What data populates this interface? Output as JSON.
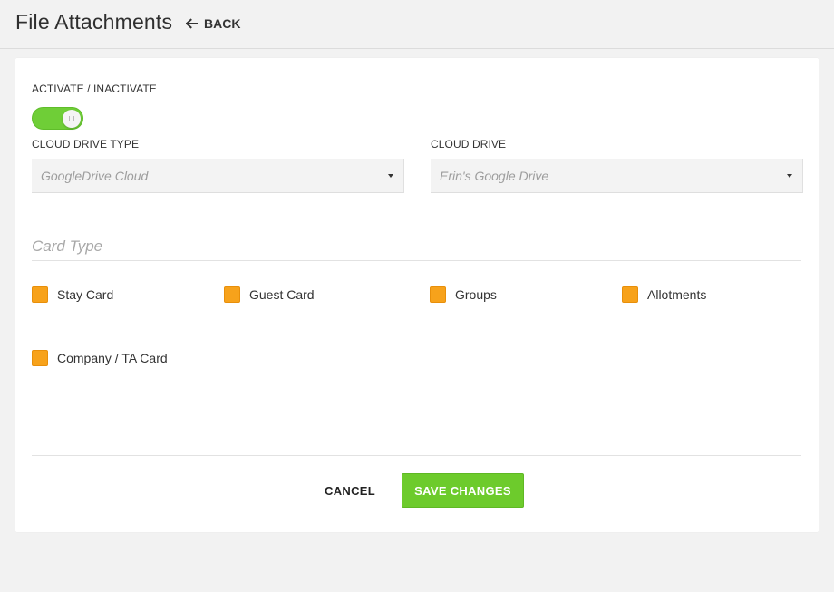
{
  "header": {
    "title": "File Attachments",
    "back_label": "BACK"
  },
  "form": {
    "activate_label": "ACTIVATE / INACTIVATE",
    "activate_on": true,
    "cloud_drive_type": {
      "label": "CLOUD DRIVE TYPE",
      "value": "GoogleDrive Cloud"
    },
    "cloud_drive": {
      "label": "CLOUD DRIVE",
      "value": "Erin's Google Drive"
    },
    "card_type": {
      "title": "Card Type",
      "options": [
        {
          "label": "Stay Card",
          "checked": true
        },
        {
          "label": "Guest Card",
          "checked": true
        },
        {
          "label": "Groups",
          "checked": true
        },
        {
          "label": "Allotments",
          "checked": true
        },
        {
          "label": "Company / TA Card",
          "checked": true
        }
      ]
    }
  },
  "actions": {
    "cancel_label": "CANCEL",
    "save_label": "SAVE CHANGES"
  },
  "colors": {
    "toggle_on": "#6fce37",
    "checkbox": "#f7a21b",
    "save_button": "#6dcb2c"
  }
}
